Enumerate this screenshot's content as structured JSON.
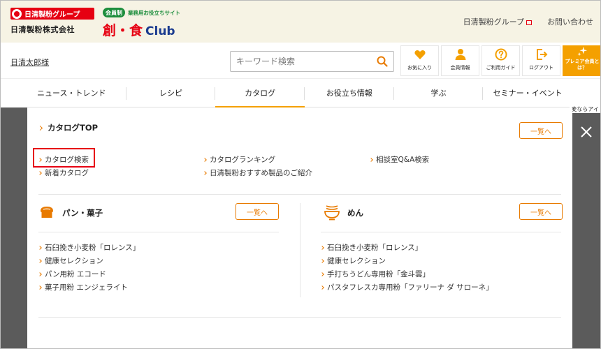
{
  "header": {
    "brand_group": "日清製粉グループ",
    "company": "日清製粉株式会社",
    "member_badge": "会員制",
    "tagline": "業務用お役立ちサイト",
    "club_kanji": "創・食",
    "club_latin": "Club",
    "links": [
      "日清製粉グループ",
      "お問い合わせ"
    ]
  },
  "user": {
    "name": "日清太郎様"
  },
  "search": {
    "placeholder": "キーワード検索"
  },
  "icon_buttons": [
    {
      "label": "お気に入り",
      "icon": "heart-icon"
    },
    {
      "label": "会員情報",
      "icon": "person-icon"
    },
    {
      "label": "ご利用ガイド",
      "icon": "help-icon"
    },
    {
      "label": "ログアウト",
      "icon": "logout-icon"
    },
    {
      "label": "プレミア会員とは？",
      "icon": "sparkle-icon"
    }
  ],
  "nav": {
    "items": [
      "ニュース・トレンド",
      "レシピ",
      "カタログ",
      "お役立ち情報",
      "学ぶ",
      "セミナー・イベント"
    ],
    "active": "カタログ"
  },
  "peek_text": "麦ならアイ",
  "colors": {
    "accent": "#e87a00",
    "brand_red": "#e60012",
    "highlight": "#e60012",
    "club_blue": "#1a3b8f"
  },
  "panel": {
    "top": {
      "title": "カタログTOP",
      "list_button": "一覧へ",
      "links": [
        "カタログ検索",
        "カタログランキング",
        "相談室Q&A検索",
        "新着カタログ",
        "日清製粉おすすめ製品のご紹介"
      ],
      "highlighted": "カタログ検索"
    },
    "pan": {
      "title": "パン・菓子",
      "icon": "bread-icon",
      "list_button": "一覧へ",
      "links": [
        "石臼挽き小麦粉「ロレンス」",
        "健康セレクション",
        "パン用粉 エコード",
        "菓子用粉 エンジェライト"
      ]
    },
    "men": {
      "title": "めん",
      "icon": "noodle-bowl-icon",
      "list_button": "一覧へ",
      "links": [
        "石臼挽き小麦粉「ロレンス」",
        "健康セレクション",
        "手打ちうどん専用粉「金斗雲」",
        "パスタフレスカ専用粉「ファリーナ ダ サローネ」"
      ]
    }
  }
}
